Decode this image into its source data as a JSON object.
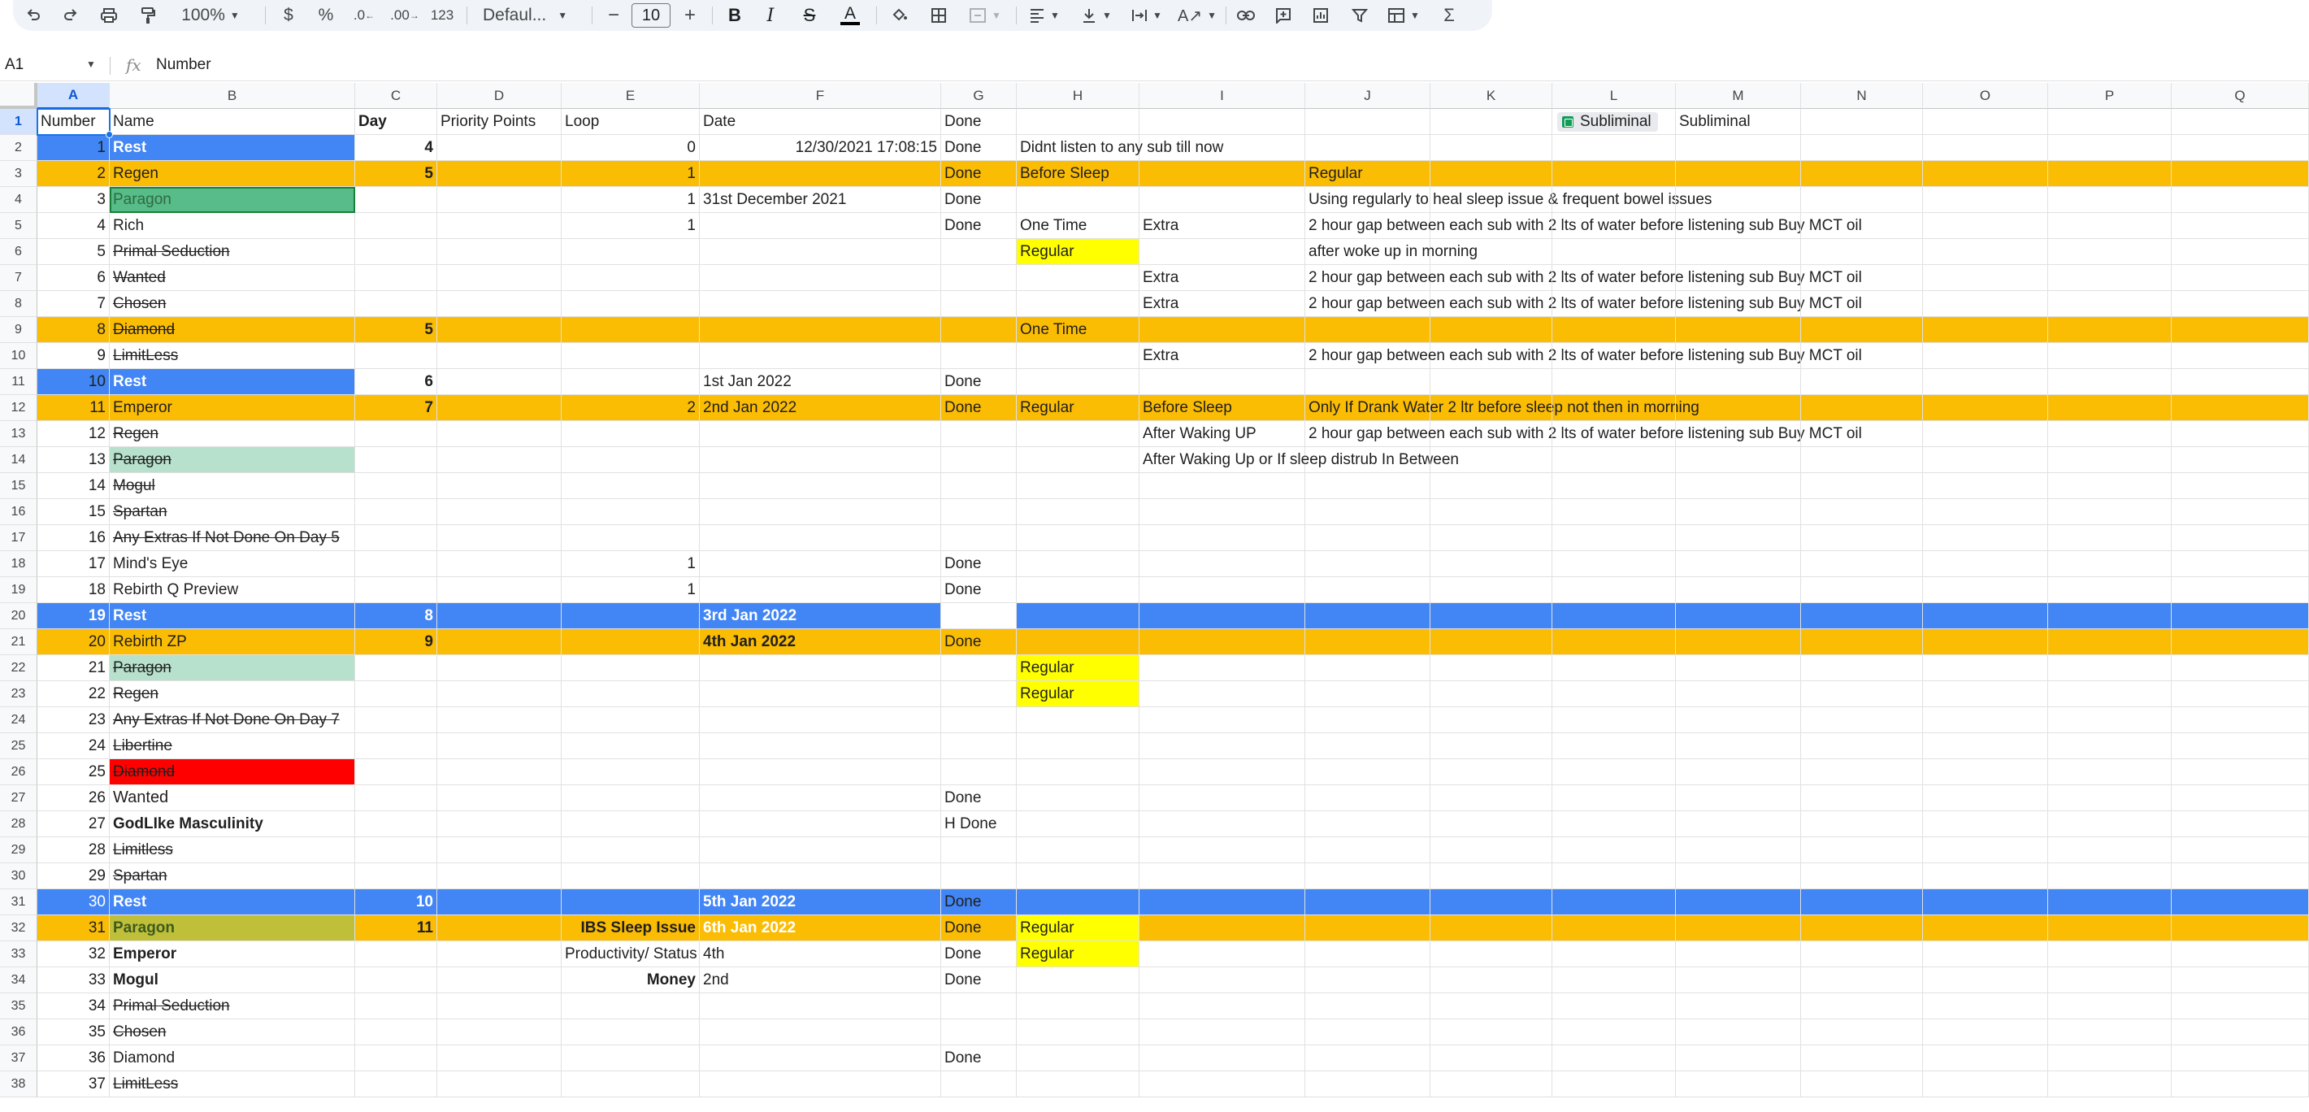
{
  "toolbar": {
    "zoom": "100%",
    "currency": "$",
    "percent": "%",
    "decrease_decimals": ".0",
    "increase_decimals": ".00",
    "number_format": "123",
    "font": "Defaul...",
    "font_size": "10",
    "minus": "−",
    "plus": "+",
    "bold": "B",
    "italic": "I",
    "strikethrough": "S",
    "text_color": "A",
    "sigma": "Σ"
  },
  "formula_bar": {
    "cell_ref": "A1",
    "fx": "fx",
    "value": "Number"
  },
  "columns": [
    "A",
    "B",
    "C",
    "D",
    "E",
    "F",
    "G",
    "H",
    "I",
    "J",
    "K",
    "L",
    "M",
    "N",
    "O",
    "P",
    "Q"
  ],
  "colors": {
    "blue": "#4285f4",
    "orange": "#fbbc04",
    "yellow": "#ffff00",
    "light_green": "#b7e1cd",
    "green": "#57bb8a",
    "red": "#ff0000",
    "olive": "#bfbf3a"
  },
  "rows": [
    {
      "n": "1",
      "cells": {
        "A": "Number",
        "B": "Name",
        "C": "Day",
        "D": "Priority Points",
        "E": "Loop",
        "F": "Date",
        "G": "Done",
        "L": "Subliminal",
        "M": "Subliminal"
      }
    },
    {
      "n": "2",
      "cells": {
        "A": "1",
        "B": "Rest",
        "C": "4",
        "E": "0",
        "F": "12/30/2021 17:08:15",
        "G": "Done",
        "H": "Didnt listen to any sub till now"
      }
    },
    {
      "n": "3",
      "cells": {
        "A": "2",
        "B": "Regen",
        "C": "5",
        "E": "1",
        "G": "Done",
        "H": "Before Sleep",
        "J": "Regular"
      }
    },
    {
      "n": "4",
      "cells": {
        "A": "3",
        "B": "Paragon",
        "E": "1",
        "F": "31st December 2021",
        "G": "Done",
        "J": "Using regularly to heal sleep issue & frequent bowel issues"
      }
    },
    {
      "n": "5",
      "cells": {
        "A": "4",
        "B": "Rich",
        "E": "1",
        "G": "Done",
        "H": "One Time",
        "I": "Extra",
        "J": "2 hour gap between each sub with 2 lts of water before listening sub Buy MCT oil"
      }
    },
    {
      "n": "6",
      "cells": {
        "A": "5",
        "B": "Primal Seduction",
        "H": "Regular",
        "J": "after woke up in morning"
      }
    },
    {
      "n": "7",
      "cells": {
        "A": "6",
        "B": "Wanted",
        "I": "Extra",
        "J": "2 hour gap between each sub with 2 lts of water before listening sub Buy MCT oil"
      }
    },
    {
      "n": "8",
      "cells": {
        "A": "7",
        "B": "Chosen",
        "I": "Extra",
        "J": "2 hour gap between each sub with 2 lts of water before listening sub Buy MCT oil"
      }
    },
    {
      "n": "9",
      "cells": {
        "A": "8",
        "B": "Diamond",
        "C": "5",
        "H": "One Time"
      }
    },
    {
      "n": "10",
      "cells": {
        "A": "9",
        "B": "LimitLess",
        "I": "Extra",
        "J": "2 hour gap between each sub with 2 lts of water before listening sub Buy MCT oil"
      }
    },
    {
      "n": "11",
      "cells": {
        "A": "10",
        "B": "Rest",
        "C": "6",
        "F": "1st Jan 2022",
        "G": "Done"
      }
    },
    {
      "n": "12",
      "cells": {
        "A": "11",
        "B": "Emperor",
        "C": "7",
        "E": "2",
        "F": "2nd Jan 2022",
        "G": "Done",
        "H": "Regular",
        "I": "Before Sleep",
        "J": "Only If Drank Water 2 ltr before sleep not then in morning"
      }
    },
    {
      "n": "13",
      "cells": {
        "A": "12",
        "B": "Regen",
        "I": "After Waking UP",
        "J": "2 hour gap between each sub with 2 lts of water before listening sub Buy MCT oil"
      }
    },
    {
      "n": "14",
      "cells": {
        "A": "13",
        "B": "Paragon",
        "I": "After Waking Up or If sleep distrub In Between"
      }
    },
    {
      "n": "15",
      "cells": {
        "A": "14",
        "B": "Mogul"
      }
    },
    {
      "n": "16",
      "cells": {
        "A": "15",
        "B": "Spartan"
      }
    },
    {
      "n": "17",
      "cells": {
        "A": "16",
        "B": "Any Extras If Not Done On Day 5"
      }
    },
    {
      "n": "18",
      "cells": {
        "A": "17",
        "B": "Mind's Eye",
        "E": "1",
        "G": "Done"
      }
    },
    {
      "n": "19",
      "cells": {
        "A": "18",
        "B": "Rebirth Q Preview",
        "E": "1",
        "G": "Done"
      }
    },
    {
      "n": "20",
      "cells": {
        "A": "19",
        "B": "Rest",
        "C": "8",
        "F": "3rd Jan 2022"
      }
    },
    {
      "n": "21",
      "cells": {
        "A": "20",
        "B": "Rebirth ZP",
        "C": "9",
        "F": "4th Jan 2022",
        "G": "Done"
      }
    },
    {
      "n": "22",
      "cells": {
        "A": "21",
        "B": "Paragon",
        "H": "Regular"
      }
    },
    {
      "n": "23",
      "cells": {
        "A": "22",
        "B": "Regen",
        "H": "Regular"
      }
    },
    {
      "n": "24",
      "cells": {
        "A": "23",
        "B": "Any Extras If Not Done On Day 7"
      }
    },
    {
      "n": "25",
      "cells": {
        "A": "24",
        "B": "Libertine"
      }
    },
    {
      "n": "26",
      "cells": {
        "A": "25",
        "B": "Diamond"
      }
    },
    {
      "n": "27",
      "cells": {
        "A": "26",
        "B": "Wanted",
        "G": "Done"
      }
    },
    {
      "n": "28",
      "cells": {
        "A": "27",
        "B": "GodLIke Masculinity",
        "G": "H Done"
      }
    },
    {
      "n": "29",
      "cells": {
        "A": "28",
        "B": "Limitless"
      }
    },
    {
      "n": "30",
      "cells": {
        "A": "29",
        "B": "Spartan"
      }
    },
    {
      "n": "31",
      "cells": {
        "A": "30",
        "B": "Rest",
        "C": "10",
        "F": "5th Jan 2022",
        "G": "Done"
      }
    },
    {
      "n": "32",
      "cells": {
        "A": "31",
        "B": "Paragon",
        "C": "11",
        "E": "IBS Sleep Issue",
        "F": "6th Jan 2022",
        "G": "Done",
        "H": "Regular"
      }
    },
    {
      "n": "33",
      "cells": {
        "A": "32",
        "B": "Emperor",
        "E": "Productivity/ Status",
        "F": "4th",
        "G": "Done",
        "H": "Regular"
      }
    },
    {
      "n": "34",
      "cells": {
        "A": "33",
        "B": "Mogul",
        "E": "Money",
        "F": "2nd",
        "G": "Done"
      }
    },
    {
      "n": "35",
      "cells": {
        "A": "34",
        "B": "Primal Seduction"
      }
    },
    {
      "n": "36",
      "cells": {
        "A": "35",
        "B": "Chosen"
      }
    },
    {
      "n": "37",
      "cells": {
        "A": "36",
        "B": "Diamond",
        "G": "Done"
      }
    },
    {
      "n": "38",
      "cells": {
        "A": "37",
        "B": "LimitLess"
      }
    }
  ]
}
